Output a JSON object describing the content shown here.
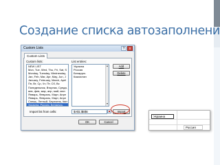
{
  "slide": {
    "title": "Создание списка автозаполнения"
  },
  "dialog": {
    "title": "Custom Lists",
    "help_glyph": "?",
    "close_glyph": "x",
    "tab_label": "Custom Lists",
    "custom_lists_label": "Custom lists:",
    "custom_lists": [
      "NEW LIST",
      "Mon, Tue, Wed, Thu, Fri, Sat, S",
      "Monday, Tuesday, Wednesday,",
      "Jan, Feb, Mar, Apr, May, Jun, J",
      "January, February, March, April",
      "Пн, Вт, Ср, Чт, Пт, Сб, Вс",
      "Понедельник, Вторник, Среда,",
      "янв, фев, мар, апр, май, июн",
      "Январь, Февраль, Март, Апре",
      "Январь, Февраль, Март, Апре",
      "Снежь, Летный, Березень, Квіт",
      "Украина, Россия, Беларусь"
    ],
    "selected_index": 11,
    "list_entries_label": "List entries:",
    "list_entries": [
      "Украина",
      "Россия",
      "Беларусь",
      "Казахстан"
    ],
    "add_button": "Add",
    "delete_button": "Delete",
    "import_label": "Import list from cells:",
    "import_value": "$A$1:$B$6",
    "import_button": "Import",
    "ok_button": "OK",
    "cancel_button": "Cancel"
  },
  "sheet": {
    "cell_a": "Украина",
    "cell_b": "Россия"
  },
  "colors": {
    "title": "#3a6ea5",
    "selection": "#316ac5",
    "callout": "#d23a2a"
  }
}
